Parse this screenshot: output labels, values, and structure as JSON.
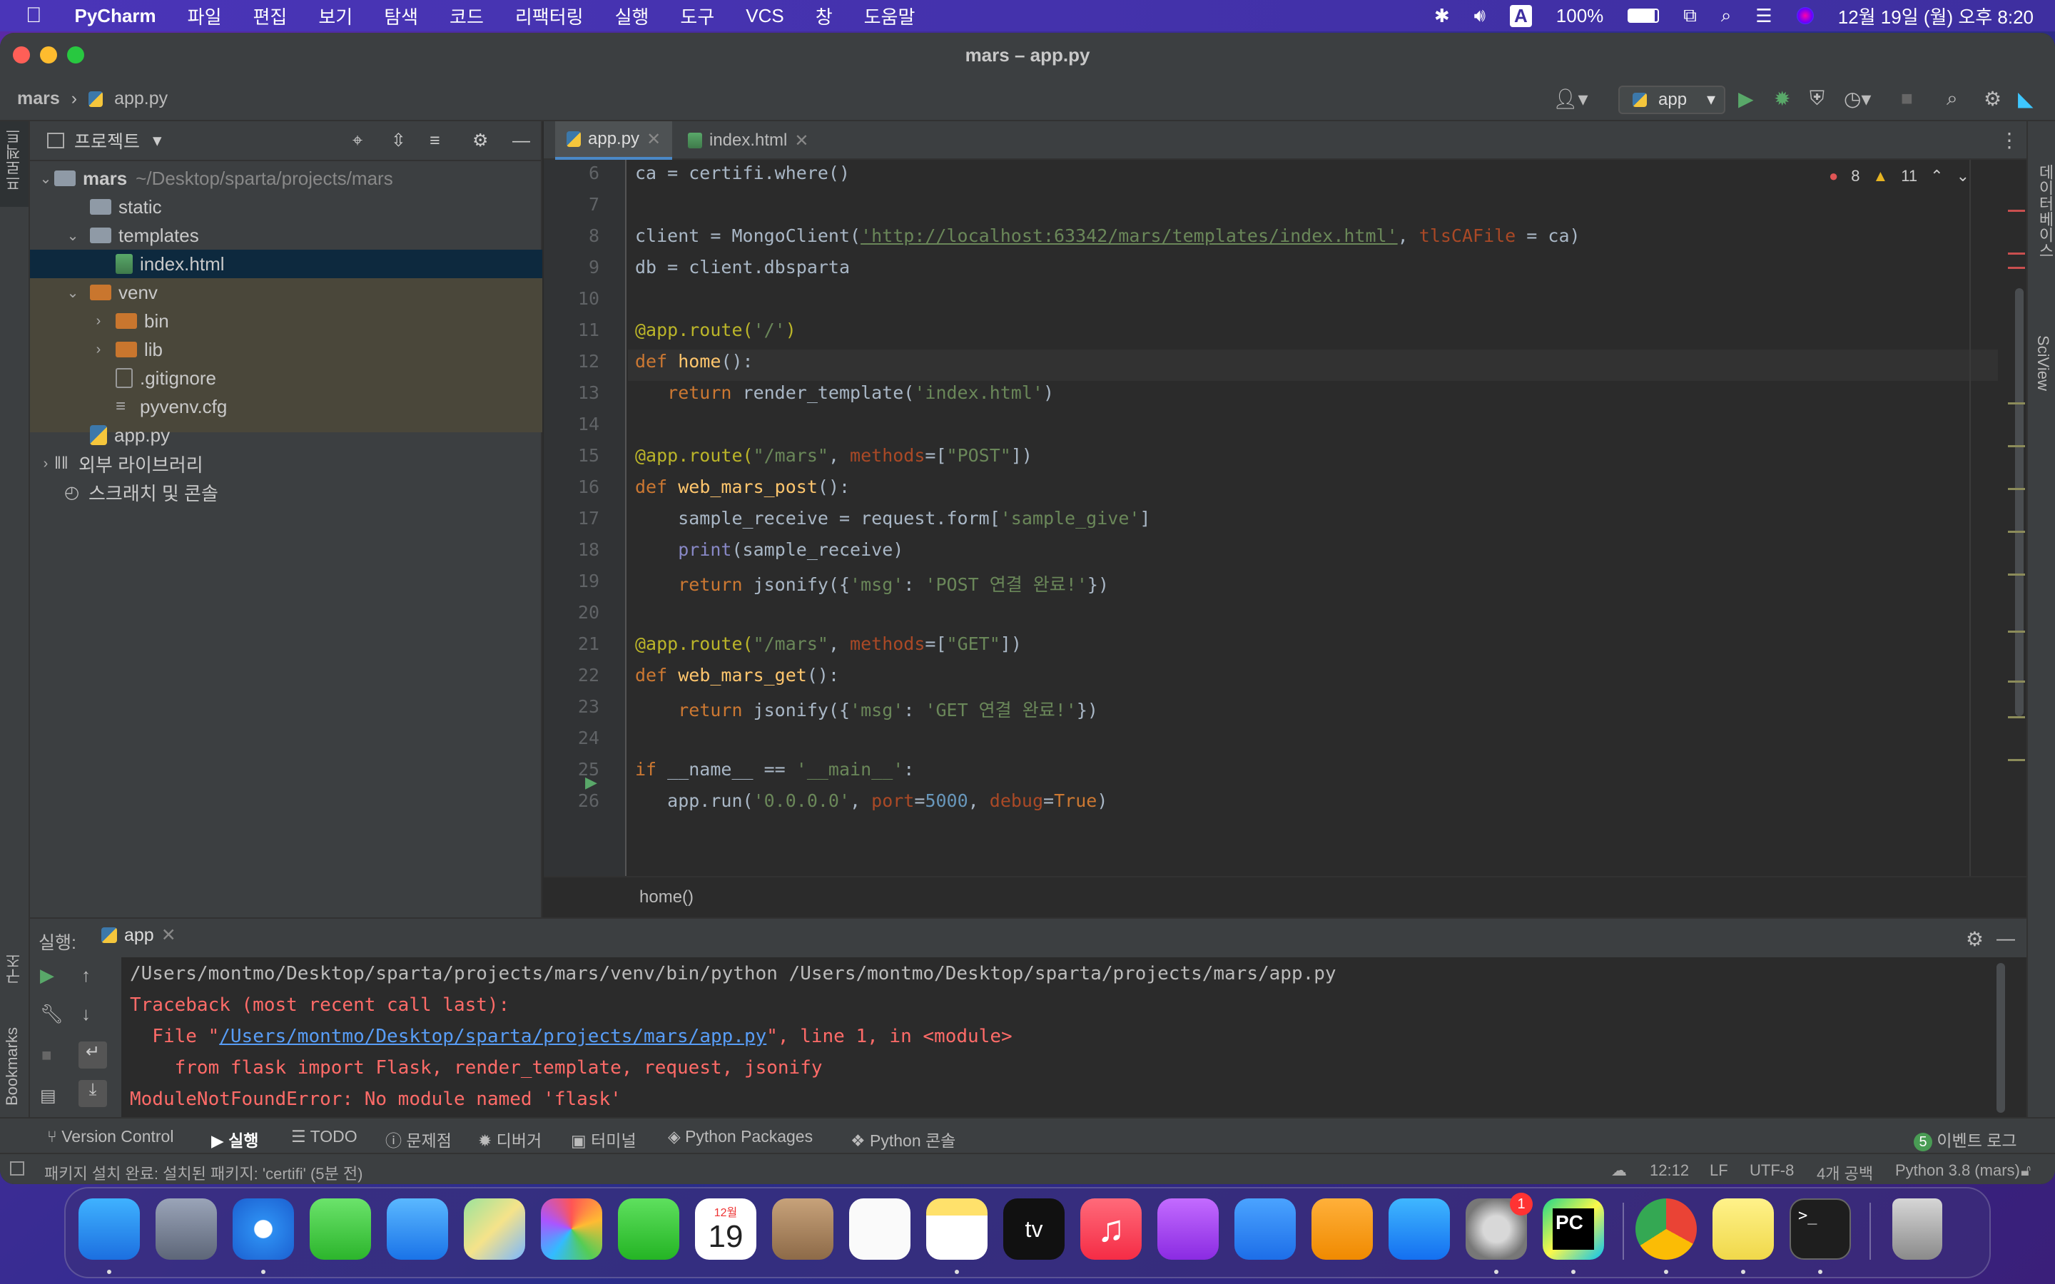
{
  "menubar": {
    "app": "PyCharm",
    "items": [
      "파일",
      "편집",
      "보기",
      "탐색",
      "코드",
      "리팩터링",
      "실행",
      "도구",
      "VCS",
      "창",
      "도움말"
    ],
    "battery": "100%",
    "input_indicator": "A",
    "datetime": "12월 19일 (월) 오후 8:20"
  },
  "window": {
    "title": "mars – app.py",
    "breadcrumb_project": "mars",
    "breadcrumb_file": "app.py",
    "run_config": "app"
  },
  "project_panel": {
    "title": "프로젝트",
    "tree": [
      {
        "label": "mars",
        "extra": "~/Desktop/sparta/projects/mars"
      },
      {
        "label": "static"
      },
      {
        "label": "templates"
      },
      {
        "label": "index.html"
      },
      {
        "label": "venv"
      },
      {
        "label": "bin"
      },
      {
        "label": "lib"
      },
      {
        "label": ".gitignore"
      },
      {
        "label": "pyvenv.cfg"
      },
      {
        "label": "app.py"
      },
      {
        "label": "외부 라이브러리"
      },
      {
        "label": "스크래치 및 콘솔"
      }
    ]
  },
  "editor": {
    "tabs": [
      "app.py",
      "index.html"
    ],
    "error_count": "8",
    "warning_count": "11",
    "line_numbers": [
      "6",
      "7",
      "8",
      "9",
      "10",
      "11",
      "12",
      "13",
      "14",
      "15",
      "16",
      "17",
      "18",
      "19",
      "20",
      "21",
      "22",
      "23",
      "24",
      "25",
      "26"
    ],
    "lines": [
      [
        {
          "t": "ca = certifi.where()",
          "c": ""
        }
      ],
      [],
      [
        {
          "t": "client = MongoClient(",
          "c": ""
        },
        {
          "t": "'http://localhost:63342/mars/templates/index.html'",
          "c": "url"
        },
        {
          "t": ", ",
          "c": ""
        },
        {
          "t": "tlsCAFile",
          "c": "par"
        },
        {
          "t": " = ca)",
          "c": ""
        }
      ],
      [
        {
          "t": "db = client.dbsparta",
          "c": ""
        }
      ],
      [],
      [
        {
          "t": "@app.route(",
          "c": "dec"
        },
        {
          "t": "'/'",
          "c": "str"
        },
        {
          "t": ")",
          "c": "dec"
        }
      ],
      [
        {
          "t": "def ",
          "c": "kw"
        },
        {
          "t": "home",
          "c": "fn"
        },
        {
          "t": "():",
          "c": ""
        }
      ],
      [
        {
          "t": "   ",
          "c": ""
        },
        {
          "t": "return ",
          "c": "kw"
        },
        {
          "t": "render_template(",
          "c": ""
        },
        {
          "t": "'index.html'",
          "c": "str"
        },
        {
          "t": ")",
          "c": ""
        }
      ],
      [],
      [
        {
          "t": "@app.route(",
          "c": "dec"
        },
        {
          "t": "\"/mars\"",
          "c": "str"
        },
        {
          "t": ", ",
          "c": ""
        },
        {
          "t": "methods",
          "c": "par"
        },
        {
          "t": "=[",
          "c": ""
        },
        {
          "t": "\"POST\"",
          "c": "str"
        },
        {
          "t": "])",
          "c": ""
        }
      ],
      [
        {
          "t": "def ",
          "c": "kw"
        },
        {
          "t": "web_mars_post",
          "c": "fn"
        },
        {
          "t": "():",
          "c": ""
        }
      ],
      [
        {
          "t": "    sample_receive = request.form[",
          "c": ""
        },
        {
          "t": "'sample_give'",
          "c": "str"
        },
        {
          "t": "]",
          "c": ""
        }
      ],
      [
        {
          "t": "    ",
          "c": ""
        },
        {
          "t": "print",
          "c": "bi"
        },
        {
          "t": "(sample_receive)",
          "c": ""
        }
      ],
      [
        {
          "t": "    ",
          "c": ""
        },
        {
          "t": "return ",
          "c": "kw"
        },
        {
          "t": "jsonify({",
          "c": ""
        },
        {
          "t": "'msg'",
          "c": "str"
        },
        {
          "t": ": ",
          "c": ""
        },
        {
          "t": "'POST 연결 완료!'",
          "c": "str"
        },
        {
          "t": "})",
          "c": ""
        }
      ],
      [],
      [
        {
          "t": "@app.route(",
          "c": "dec"
        },
        {
          "t": "\"/mars\"",
          "c": "str"
        },
        {
          "t": ", ",
          "c": ""
        },
        {
          "t": "methods",
          "c": "par"
        },
        {
          "t": "=[",
          "c": ""
        },
        {
          "t": "\"GET\"",
          "c": "str"
        },
        {
          "t": "])",
          "c": ""
        }
      ],
      [
        {
          "t": "def ",
          "c": "kw"
        },
        {
          "t": "web_mars_get",
          "c": "fn"
        },
        {
          "t": "():",
          "c": ""
        }
      ],
      [
        {
          "t": "    ",
          "c": ""
        },
        {
          "t": "return ",
          "c": "kw"
        },
        {
          "t": "jsonify({",
          "c": ""
        },
        {
          "t": "'msg'",
          "c": "str"
        },
        {
          "t": ": ",
          "c": ""
        },
        {
          "t": "'GET 연결 완료!'",
          "c": "str"
        },
        {
          "t": "})",
          "c": ""
        }
      ],
      [],
      [
        {
          "t": "if ",
          "c": "kw"
        },
        {
          "t": "__name__ == ",
          "c": ""
        },
        {
          "t": "'__main__'",
          "c": "str"
        },
        {
          "t": ":",
          "c": ""
        }
      ],
      [
        {
          "t": "   app.run(",
          "c": ""
        },
        {
          "t": "'0.0.0.0'",
          "c": "str"
        },
        {
          "t": ", ",
          "c": ""
        },
        {
          "t": "port",
          "c": "par"
        },
        {
          "t": "=",
          "c": ""
        },
        {
          "t": "5000",
          "c": "num"
        },
        {
          "t": ", ",
          "c": ""
        },
        {
          "t": "debug",
          "c": "par"
        },
        {
          "t": "=",
          "c": ""
        },
        {
          "t": "True",
          "c": "kw"
        },
        {
          "t": ")",
          "c": ""
        }
      ]
    ],
    "breadcrumb": "home()"
  },
  "run_panel": {
    "label": "실행:",
    "tab": "app",
    "cmd": "/Users/montmo/Desktop/sparta/projects/mars/venv/bin/python /Users/montmo/Desktop/sparta/projects/mars/app.py",
    "tb1": "Traceback (most recent call last):",
    "tb2_pre": "  File \"",
    "tb2_link": "/Users/montmo/Desktop/sparta/projects/mars/app.py",
    "tb2_post": "\", line 1, in <module>",
    "tb3": "    from flask import Flask, render_template, request, jsonify",
    "tb4": "ModuleNotFoundError: No module named 'flask'"
  },
  "side_labels": {
    "left_top": "프로젝트",
    "left_mid": "구조",
    "left_bottom": "Bookmarks",
    "right_top": "데이터베이스",
    "right_mid": "SciView"
  },
  "tool_windows": [
    "Version Control",
    "실행",
    "TODO",
    "문제점",
    "디버거",
    "터미널",
    "Python Packages",
    "Python 콘솔"
  ],
  "event_log": {
    "count": "5",
    "label": "이벤트 로그"
  },
  "status": {
    "message": "패키지 설치 완료: 설치된 패키지: 'certifi' (5분 전)",
    "position": "12:12",
    "line_sep": "LF",
    "encoding": "UTF-8",
    "indent": "4개 공백",
    "interpreter": "Python 3.8 (mars)"
  },
  "dock": {
    "calendar_month": "12월",
    "calendar_day": "19",
    "settings_badge": "1"
  }
}
